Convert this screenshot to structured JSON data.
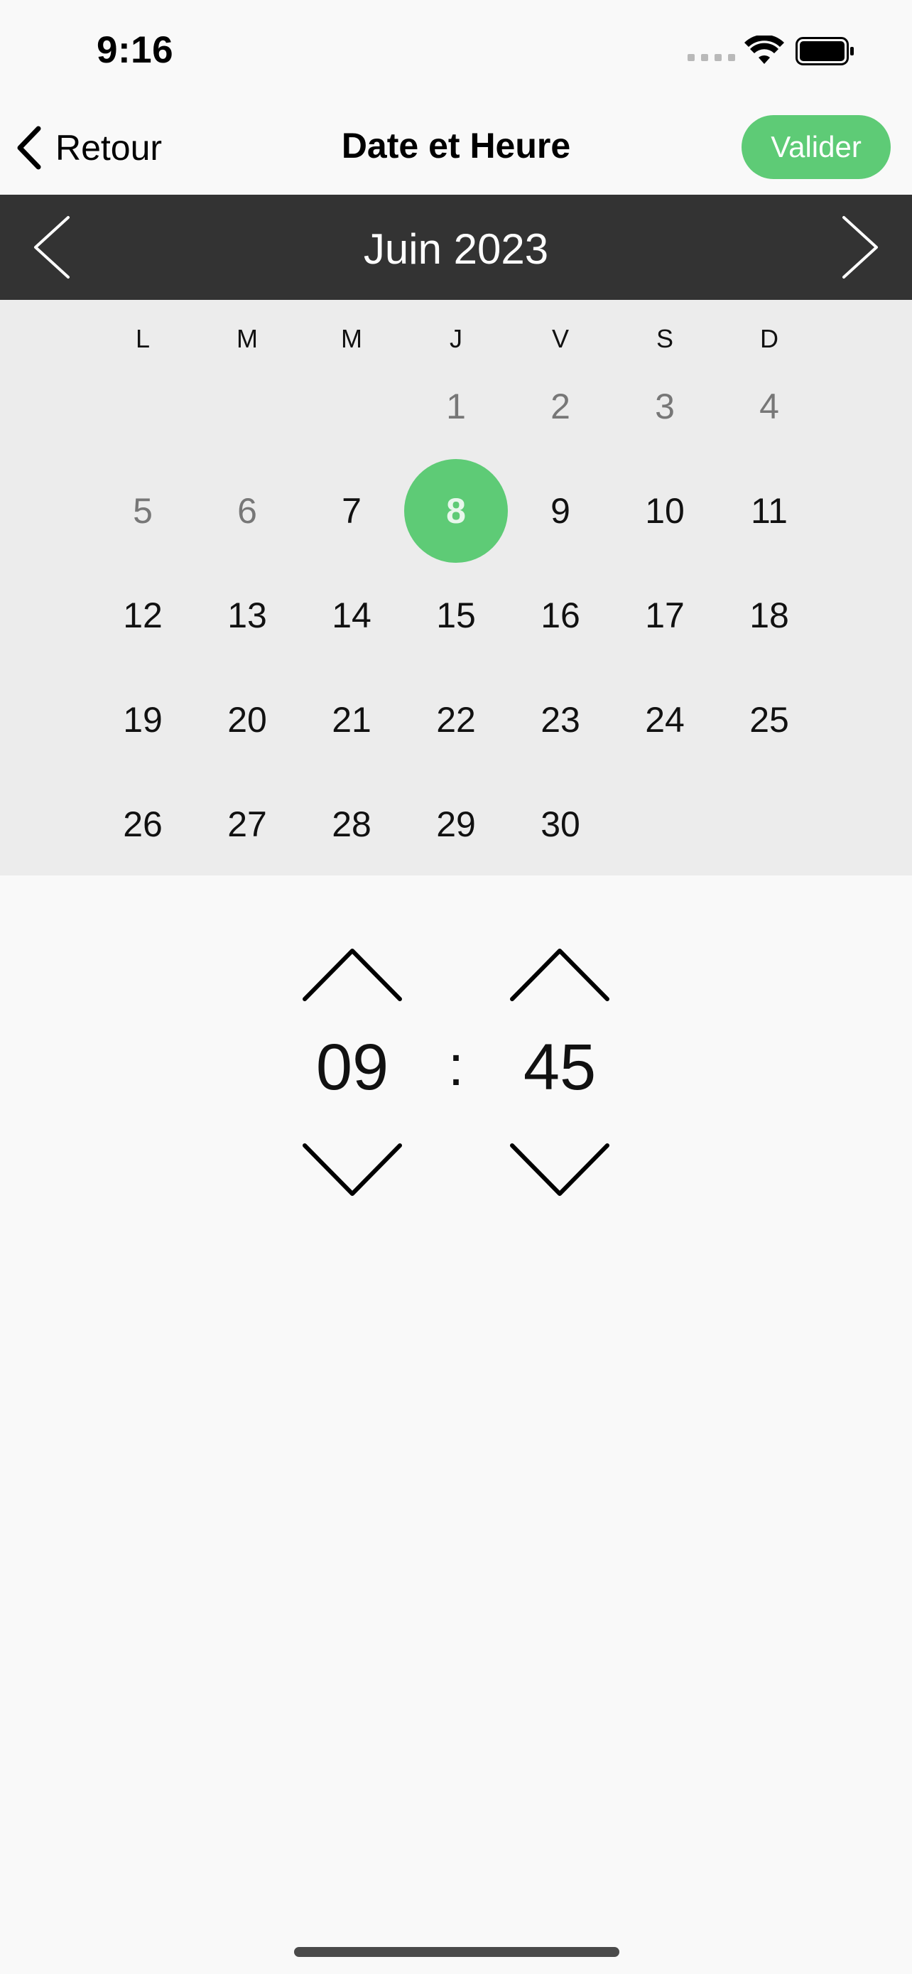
{
  "status_bar": {
    "time": "9:16"
  },
  "nav": {
    "back_label": "Retour",
    "title": "Date et Heure",
    "confirm_label": "Valider"
  },
  "calendar": {
    "month_label": "Juin 2023",
    "weekdays": [
      "L",
      "M",
      "M",
      "J",
      "V",
      "S",
      "D"
    ],
    "selected_day": "8",
    "weeks": [
      [
        {
          "d": "",
          "m": false
        },
        {
          "d": "",
          "m": false
        },
        {
          "d": "",
          "m": false
        },
        {
          "d": "1",
          "m": true
        },
        {
          "d": "2",
          "m": true
        },
        {
          "d": "3",
          "m": true
        },
        {
          "d": "4",
          "m": true
        }
      ],
      [
        {
          "d": "5",
          "m": true
        },
        {
          "d": "6",
          "m": true
        },
        {
          "d": "7",
          "m": false
        },
        {
          "d": "8",
          "m": false
        },
        {
          "d": "9",
          "m": false
        },
        {
          "d": "10",
          "m": false
        },
        {
          "d": "11",
          "m": false
        }
      ],
      [
        {
          "d": "12",
          "m": false
        },
        {
          "d": "13",
          "m": false
        },
        {
          "d": "14",
          "m": false
        },
        {
          "d": "15",
          "m": false
        },
        {
          "d": "16",
          "m": false
        },
        {
          "d": "17",
          "m": false
        },
        {
          "d": "18",
          "m": false
        }
      ],
      [
        {
          "d": "19",
          "m": false
        },
        {
          "d": "20",
          "m": false
        },
        {
          "d": "21",
          "m": false
        },
        {
          "d": "22",
          "m": false
        },
        {
          "d": "23",
          "m": false
        },
        {
          "d": "24",
          "m": false
        },
        {
          "d": "25",
          "m": false
        }
      ],
      [
        {
          "d": "26",
          "m": false
        },
        {
          "d": "27",
          "m": false
        },
        {
          "d": "28",
          "m": false
        },
        {
          "d": "29",
          "m": false
        },
        {
          "d": "30",
          "m": false
        },
        {
          "d": "",
          "m": false
        },
        {
          "d": "",
          "m": false
        }
      ]
    ]
  },
  "time": {
    "hours": "09",
    "separator": ":",
    "minutes": "45"
  },
  "colors": {
    "accent": "#5ecb76",
    "header_bg": "#333333",
    "calendar_bg": "#ececec"
  },
  "icons": {
    "back": "chevron-left-icon",
    "prev_month": "chevron-left-icon",
    "next_month": "chevron-right-icon",
    "increment": "chevron-up-icon",
    "decrement": "chevron-down-icon"
  }
}
